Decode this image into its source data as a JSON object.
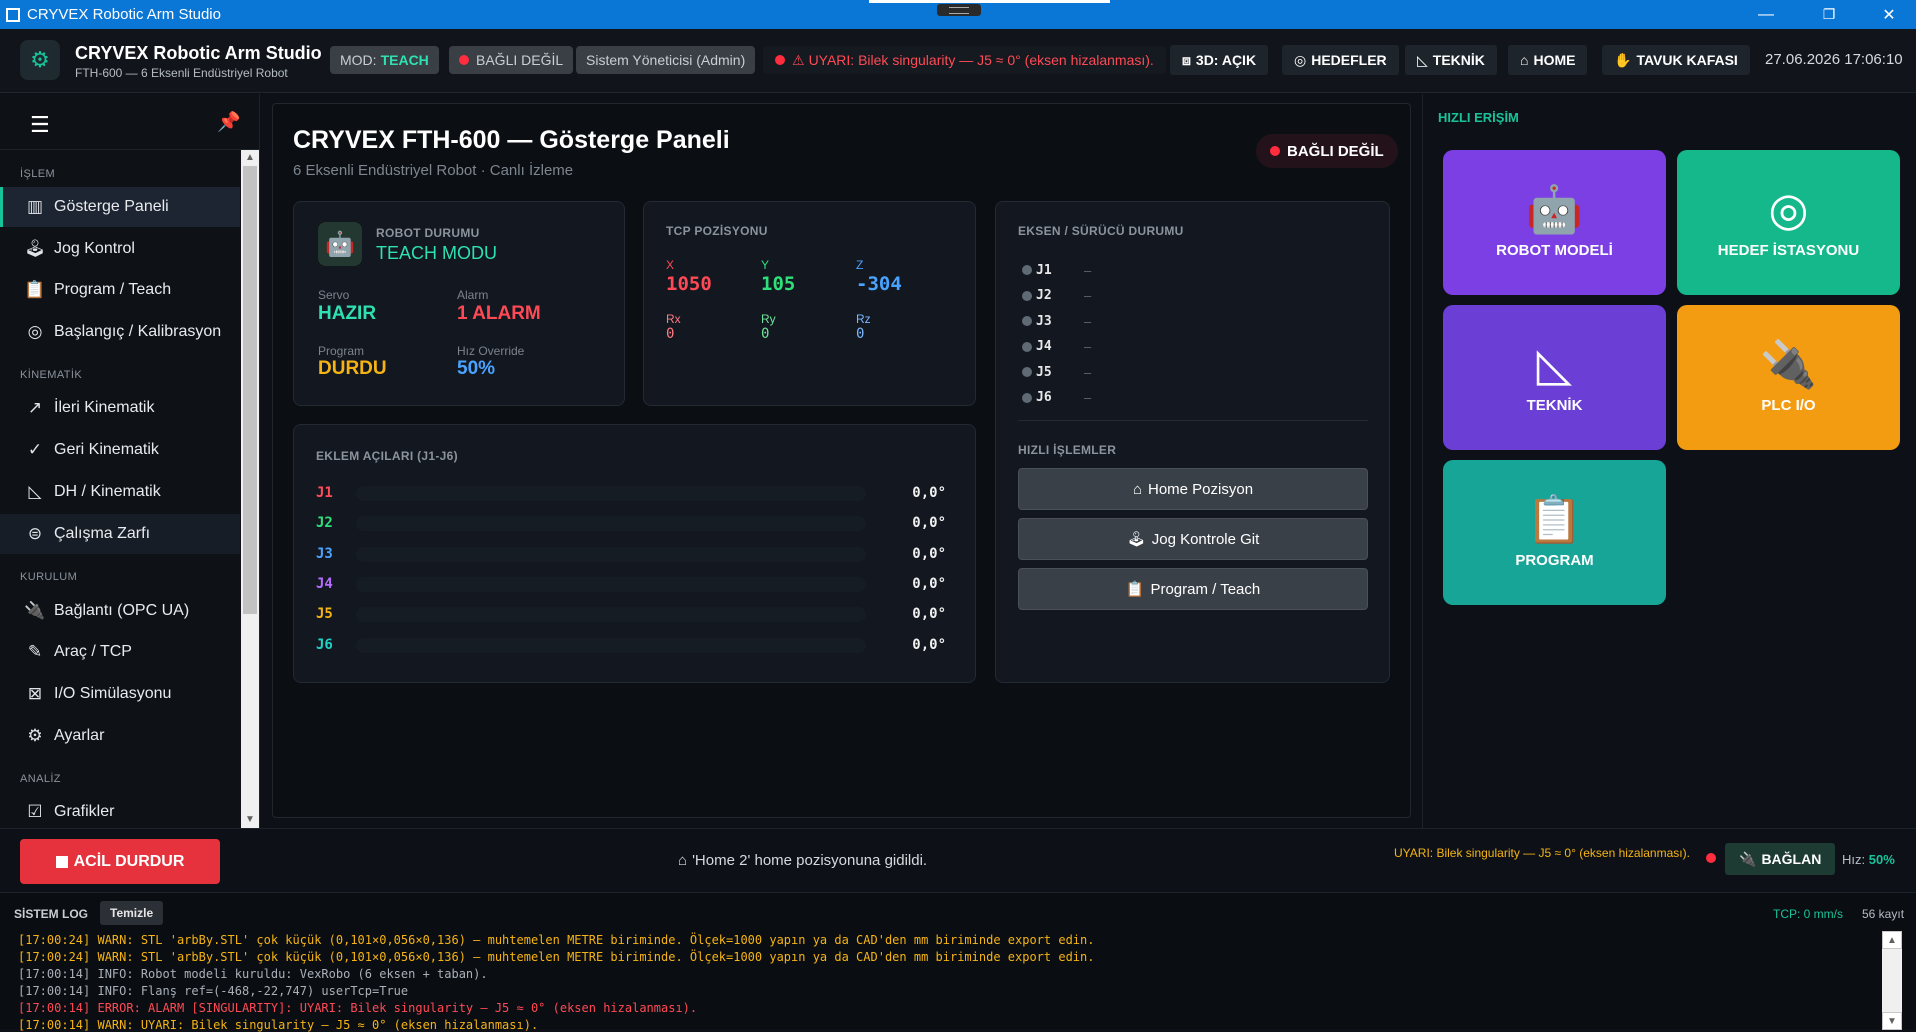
{
  "window": {
    "title": "CRYVEX Robotic Arm Studio",
    "minimize": "—",
    "maximize": "❐",
    "close": "✕"
  },
  "header": {
    "title": "CRYVEX Robotic Arm Studio",
    "subtitle": "FTH-600 — 6 Eksenli Endüstriyel Robot",
    "mode_label": "MOD:",
    "mode_value": "TEACH",
    "connection": "BAĞLI DEĞİL",
    "user": "Sistem Yöneticisi (Admin)",
    "warning": "UYARI: Bilek singularity — J5 ≈ 0° (eksen hizalanması).",
    "nav": {
      "view3d": "3D: AÇIK",
      "targets": "HEDEFLER",
      "technical": "TEKNİK",
      "home": "HOME",
      "gripper": "TAVUK KAFASI"
    },
    "datetime": "27.06.2026  17:06:10"
  },
  "sidebar": {
    "sections": {
      "process": "İŞLEM",
      "kinematics": "KİNEMATİK",
      "setup": "KURULUM",
      "analysis": "ANALİZ"
    },
    "items": {
      "dashboard": "Gösterge Paneli",
      "jog": "Jog Kontrol",
      "program": "Program / Teach",
      "calibration": "Başlangıç / Kalibrasyon",
      "forward": "İleri Kinematik",
      "inverse": "Geri Kinematik",
      "dh": "DH / Kinematik",
      "workspace": "Çalışma Zarfı",
      "connection": "Bağlantı (OPC UA)",
      "tool": "Araç / TCP",
      "io": "I/O Simülasyonu",
      "settings": "Ayarlar",
      "charts": "Grafikler"
    }
  },
  "main": {
    "title": "CRYVEX FTH-600 — Gösterge Paneli",
    "subtitle": "6 Eksenli Endüstriyel Robot · Canlı İzleme",
    "connection_badge": "BAĞLI DEĞİL",
    "robot_status": {
      "title": "ROBOT DURUMU",
      "mode": "TEACH MODU",
      "servo_label": "Servo",
      "servo_value": "HAZIR",
      "alarm_label": "Alarm",
      "alarm_value": "1 ALARM",
      "program_label": "Program",
      "program_value": "DURDU",
      "override_label": "Hız Override",
      "override_value": "50%"
    },
    "tcp": {
      "title": "TCP POZİSYONU",
      "x_label": "X",
      "x": "1050",
      "y_label": "Y",
      "y": "105",
      "z_label": "Z",
      "z": "-304",
      "rx_label": "Rx",
      "rx": "0",
      "ry_label": "Ry",
      "ry": "0",
      "rz_label": "Rz",
      "rz": "0"
    },
    "axes": {
      "title": "EKSEN / SÜRÜCÜ DURUMU",
      "rows": [
        {
          "name": "J1",
          "state": "–"
        },
        {
          "name": "J2",
          "state": "–"
        },
        {
          "name": "J3",
          "state": "–"
        },
        {
          "name": "J4",
          "state": "–"
        },
        {
          "name": "J5",
          "state": "–"
        },
        {
          "name": "J6",
          "state": "–"
        }
      ]
    },
    "joints": {
      "title": "EKLEM AÇILARI (J1-J6)",
      "rows": [
        {
          "name": "J1",
          "value": "0,0°",
          "fill": 0,
          "color": "#ff4d5a"
        },
        {
          "name": "J2",
          "value": "0,0°",
          "fill": 0,
          "color": "#2fe07a"
        },
        {
          "name": "J3",
          "value": "0,0°",
          "fill": 0,
          "color": "#4aa3ff"
        },
        {
          "name": "J4",
          "value": "0,0°",
          "fill": 0,
          "color": "#b56cff"
        },
        {
          "name": "J5",
          "value": "0,0°",
          "fill": 0,
          "color": "#f5b414"
        },
        {
          "name": "J6",
          "value": "0,0°",
          "fill": 0,
          "color": "#22d3c5"
        }
      ]
    },
    "quick_ops": {
      "title": "HIZLI İŞLEMLER",
      "home": "Home Pozisyon",
      "jog": "Jog Kontrole Git",
      "program": "Program / Teach"
    }
  },
  "quick_access": {
    "title": "HIZLI ERİŞİM",
    "tiles": {
      "robot_model": "ROBOT MODELİ",
      "target_station": "HEDEF İSTASYONU",
      "technical": "TEKNİK",
      "plc_io": "PLC I/O",
      "program": "PROGRAM"
    },
    "colors": {
      "robot_model": "#7b3fe4",
      "target_station": "#14b88a",
      "technical": "#6b3fd6",
      "plc_io": "#f39c12",
      "program": "#17a597"
    }
  },
  "actionbar": {
    "estop": "ACİL DURDUR",
    "status": "'Home 2' home pozisyonuna gidildi.",
    "warning": "UYARI: Bilek singularity — J5 ≈ 0° (eksen hizalanması).",
    "connect": "BAĞLAN",
    "speed_label": "Hız:",
    "speed_value": "50%"
  },
  "log": {
    "title": "SİSTEM LOG",
    "clear": "Temizle",
    "tcp_speed": "TCP: 0 mm/s",
    "count": "56 kayıt",
    "lines": [
      {
        "text": "[17:00:24] WARN: STL 'arbBy.STL' çok küçük (0,101×0,056×0,136) — muhtemelen METRE biriminde. Ölçek=1000 yapın ya da CAD'den mm biriminde export edin.",
        "color": "#f5b414"
      },
      {
        "text": "[17:00:24] WARN: STL 'arbBy.STL' çok küçük (0,101×0,056×0,136) — muhtemelen METRE biriminde. Ölçek=1000 yapın ya da CAD'den mm biriminde export edin.",
        "color": "#f5b414"
      },
      {
        "text": "[17:00:14] INFO: Robot modeli kuruldu: VexRobo (6 eksen + taban).",
        "color": "#a9b0b8"
      },
      {
        "text": "[17:00:14] INFO: Flanş ref=(-468,-22,747) userTcp=True",
        "color": "#a9b0b8"
      },
      {
        "text": "[17:00:14] ERROR: ALARM [SINGULARITY]: UYARI: Bilek singularity — J5 ≈ 0° (eksen hizalanması).",
        "color": "#ff4a55"
      },
      {
        "text": "[17:00:14] WARN: UYARI: Bilek singularity — J5 ≈ 0° (eksen hizalanması).",
        "color": "#f5b414"
      }
    ]
  }
}
